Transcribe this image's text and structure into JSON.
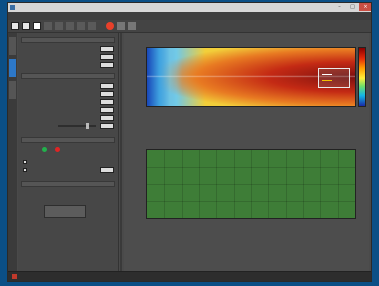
{
  "window": {
    "title": "",
    "minimize_label": "–",
    "maximize_label": "□",
    "close_label": "×"
  },
  "menu": {
    "items": [
      "",
      "",
      "",
      ""
    ]
  },
  "side_tabs": [
    "",
    "",
    ""
  ],
  "left_panel": {
    "section1": {
      "header": "",
      "rows": [
        {
          "label": "",
          "value": ""
        },
        {
          "label": "",
          "value": ""
        },
        {
          "label": "",
          "value": ""
        }
      ]
    },
    "section2": {
      "header": "",
      "rows": [
        {
          "label": "",
          "value": ""
        },
        {
          "label": "",
          "value": ""
        },
        {
          "label": "",
          "value": ""
        },
        {
          "label": "",
          "value": ""
        },
        {
          "label": "",
          "value": ""
        },
        {
          "label": "",
          "value": ""
        }
      ]
    },
    "section3": {
      "header": "",
      "status_ok_color": "#22b14c",
      "status_err_color": "#e02424",
      "check1_label": "",
      "check2_label": "",
      "value": ""
    },
    "section4": {
      "header": "",
      "option1": "",
      "option2": "",
      "button_label": ""
    },
    "footer_label": ""
  },
  "top_plot": {
    "title": "",
    "x_ticks": [
      "",
      "",
      "",
      "",
      "",
      ""
    ],
    "y_ticks": [
      "",
      "",
      "",
      ""
    ],
    "xlabel": "",
    "colorbar_ticks": [
      "",
      "",
      "",
      ""
    ],
    "legend": [
      {
        "label": "",
        "color": "#ffffff"
      },
      {
        "label": "",
        "color": "#f2c200"
      }
    ],
    "colors": {
      "core": "#8a0f0f",
      "mid": "#e8661f",
      "outer": "#f1c23c",
      "edge_blue": "#1846b8"
    }
  },
  "bottom_plot": {
    "title": "",
    "x_ticks": [
      "",
      "",
      "",
      "",
      "",
      ""
    ],
    "y_ticks": [
      "",
      "",
      ""
    ],
    "xlabel": "",
    "fill_color": "#3e7d37",
    "gridline_count": 12
  },
  "bottom_info": {
    "line1": "",
    "line2": "",
    "line3": ""
  },
  "statusbar": {
    "left": "",
    "right": ""
  }
}
